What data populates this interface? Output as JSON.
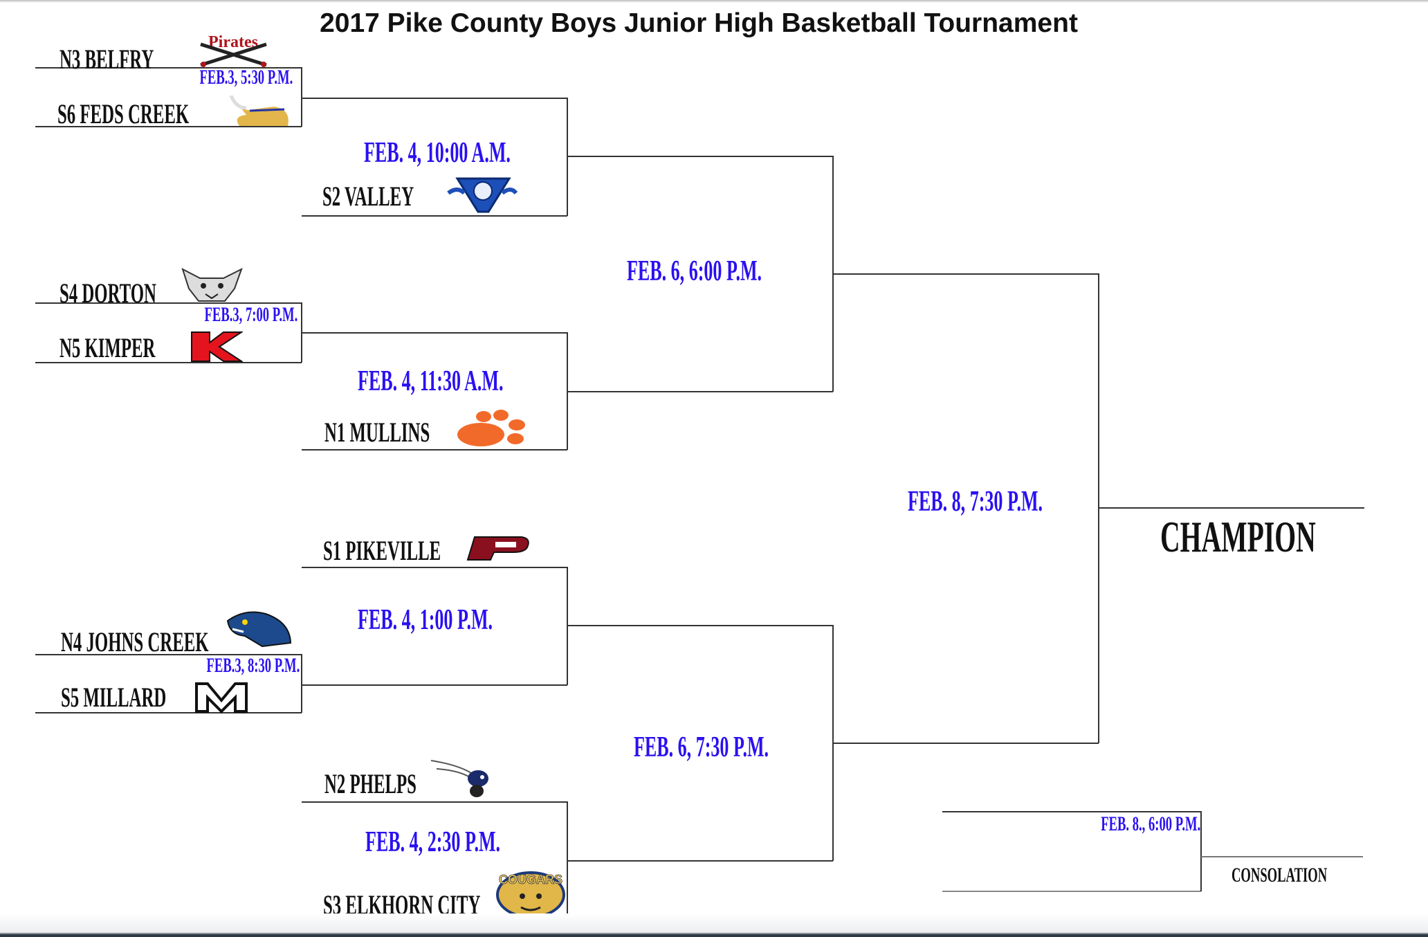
{
  "title": "2017 Pike County Boys Junior High Basketball Tournament",
  "colors": {
    "date_text": "#2a10f0",
    "team_text": "#111111",
    "lines": "#333333"
  },
  "round1": [
    {
      "top": "N3   BELFRY",
      "bottom": "S6   FEDS  CREEK",
      "date": "FEB.3, 5:30  P.M.",
      "logos": [
        "pirates-logo",
        "viking-logo"
      ]
    },
    {
      "top": "S4  DORTON",
      "bottom": "N5  KIMPER",
      "date": "FEB.3,  7:00  P.M.",
      "logos": [
        "wildcat-logo",
        "k-logo"
      ]
    },
    {
      "top": "N4  JOHNS  CREEK",
      "bottom": "S5  MILLARD",
      "date": "FEB.3, 8:30  P.M.",
      "logos": [
        "panther-logo",
        "m-logo"
      ]
    }
  ],
  "round2": [
    {
      "team": "S2  VALLEY",
      "date": "FEB. 4,  10:00  A.M.",
      "logo": "valley-wildcat-logo"
    },
    {
      "team": "N1  MULLINS",
      "date": "FEB.  4,  11:30  A.M.",
      "logo": "paw-logo"
    },
    {
      "team": "S1  PIKEVILLE",
      "date": "FEB. 4,  1:00  P.M.",
      "logo": "p-logo"
    },
    {
      "team": "N2  PHELPS",
      "date": "FEB.  4,  2:30  P.M.",
      "logo": "hornet-logo"
    },
    {
      "team": "S3  ELKHORN  CITY",
      "date": "",
      "logo": "cougars-logo"
    }
  ],
  "round3": [
    {
      "date": "FEB.  6,  6:00  P.M."
    },
    {
      "date": "FEB.  6,  7:30  P.M."
    }
  ],
  "final": {
    "date": "FEB. 8,  7:30  P.M.",
    "champion_label": "CHAMPION"
  },
  "consolation": {
    "date": "FEB. 8.,  6:00  P.M.",
    "label": "CONSOLATION"
  }
}
